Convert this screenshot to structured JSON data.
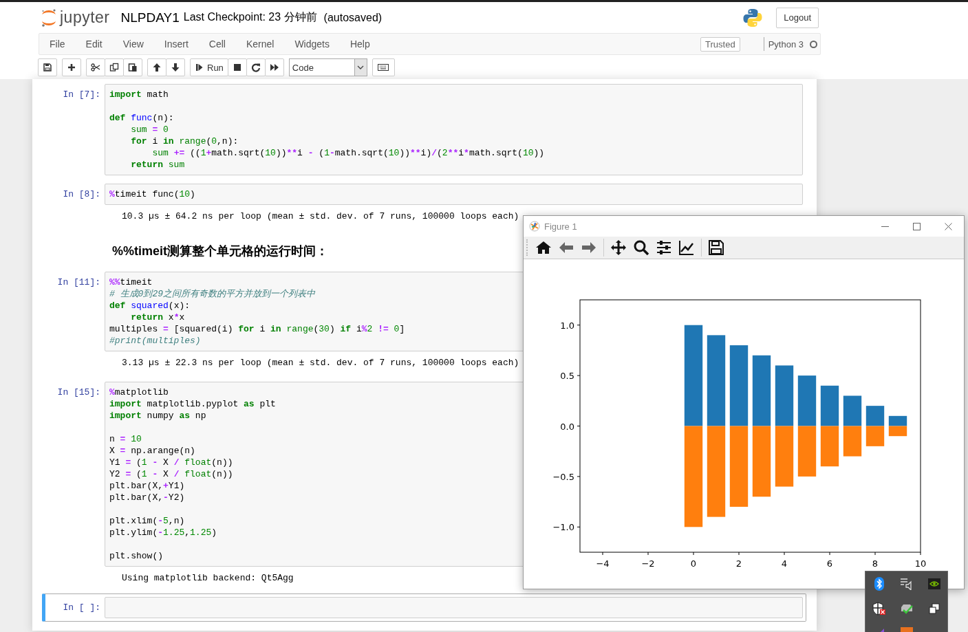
{
  "header": {
    "logo_text": "jupyter",
    "notebook_name": "NLPDAY1",
    "checkpoint": "Last Checkpoint: 23 分钟前",
    "autosave": "(autosaved)",
    "logout": "Logout"
  },
  "menu": [
    "File",
    "Edit",
    "View",
    "Insert",
    "Cell",
    "Kernel",
    "Widgets",
    "Help"
  ],
  "trusted": "Trusted",
  "kernel": {
    "name": "Python 3",
    "busy": false
  },
  "toolbar": {
    "run_label": "Run",
    "cell_type": "Code"
  },
  "cells": [
    {
      "kind": "code",
      "prompt": "In [7]:",
      "selected": false,
      "lines": [
        {
          "tokens": [
            {
              "kind": "kw",
              "text": "import"
            },
            {
              "kind": "name",
              "text": " math"
            }
          ]
        },
        {
          "space_before": true,
          "tokens": [
            {
              "kind": "kw",
              "text": "def"
            },
            {
              "kind": "fn",
              "text": " func"
            },
            {
              "kind": "name",
              "text": "(n):"
            }
          ]
        },
        {
          "tokens": [
            {
              "kind": "builtin",
              "text": "    sum"
            },
            {
              "kind": "op",
              "text": " ="
            },
            {
              "kind": "num",
              "text": " 0"
            }
          ]
        },
        {
          "tokens": [
            {
              "kind": "kw",
              "text": "    for"
            },
            {
              "kind": "name",
              "text": " i "
            },
            {
              "kind": "kw",
              "text": "in"
            },
            {
              "kind": "builtin",
              "text": " range"
            },
            {
              "kind": "name",
              "text": "("
            },
            {
              "kind": "num",
              "text": "0"
            },
            {
              "kind": "name",
              "text": ",n):"
            }
          ]
        },
        {
          "tokens": [
            {
              "kind": "builtin",
              "text": "        sum"
            },
            {
              "kind": "op",
              "text": " +="
            },
            {
              "kind": "name",
              "text": " (("
            },
            {
              "kind": "num",
              "text": "1"
            },
            {
              "kind": "op",
              "text": "+"
            },
            {
              "kind": "name",
              "text": "math.sqrt("
            },
            {
              "kind": "num",
              "text": "10"
            },
            {
              "kind": "name",
              "text": "))"
            },
            {
              "kind": "op",
              "text": "**"
            },
            {
              "kind": "name",
              "text": "i "
            },
            {
              "kind": "op",
              "text": "-"
            },
            {
              "kind": "name",
              "text": " ("
            },
            {
              "kind": "num",
              "text": "1"
            },
            {
              "kind": "op",
              "text": "-"
            },
            {
              "kind": "name",
              "text": "math.sqrt("
            },
            {
              "kind": "num",
              "text": "10"
            },
            {
              "kind": "name",
              "text": "))"
            },
            {
              "kind": "op",
              "text": "**"
            },
            {
              "kind": "name",
              "text": "i)"
            },
            {
              "kind": "op",
              "text": "/"
            },
            {
              "kind": "name",
              "text": "("
            },
            {
              "kind": "num",
              "text": "2"
            },
            {
              "kind": "op",
              "text": "**"
            },
            {
              "kind": "name",
              "text": "i"
            },
            {
              "kind": "op",
              "text": "*"
            },
            {
              "kind": "name",
              "text": "math.sqrt("
            },
            {
              "kind": "num",
              "text": "10"
            },
            {
              "kind": "name",
              "text": "))"
            }
          ]
        },
        {
          "tokens": [
            {
              "kind": "kw",
              "text": "    return"
            },
            {
              "kind": "builtin",
              "text": " sum"
            }
          ]
        }
      ]
    },
    {
      "kind": "code",
      "prompt": "In [8]:",
      "selected": false,
      "lines": [
        {
          "tokens": [
            {
              "kind": "magic",
              "text": "%"
            },
            {
              "kind": "name",
              "text": "timeit func("
            },
            {
              "kind": "num",
              "text": "10"
            },
            {
              "kind": "name",
              "text": ")"
            }
          ]
        }
      ],
      "output": "10.3 µs ± 64.2 ns per loop (mean ± std. dev. of 7 runs, 100000 loops each)"
    },
    {
      "kind": "markdown",
      "heading": "%%timeit测算整个单元格的运行时间："
    },
    {
      "kind": "code",
      "prompt": "In [11]:",
      "selected": false,
      "lines": [
        {
          "tokens": [
            {
              "kind": "magic",
              "text": "%%"
            },
            {
              "kind": "name",
              "text": "timeit"
            }
          ]
        },
        {
          "tokens": [
            {
              "kind": "comment",
              "text": "# 生成0到29之间所有奇数的平方并放到一个列表中"
            }
          ]
        },
        {
          "tokens": [
            {
              "kind": "kw",
              "text": "def"
            },
            {
              "kind": "fn",
              "text": " squared"
            },
            {
              "kind": "name",
              "text": "(x):"
            }
          ]
        },
        {
          "tokens": [
            {
              "kind": "kw",
              "text": "    return"
            },
            {
              "kind": "name",
              "text": " x"
            },
            {
              "kind": "op",
              "text": "*"
            },
            {
              "kind": "name",
              "text": "x"
            }
          ]
        },
        {
          "tokens": [
            {
              "kind": "name",
              "text": "multiples "
            },
            {
              "kind": "op",
              "text": "="
            },
            {
              "kind": "name",
              "text": " [squared(i) "
            },
            {
              "kind": "kw",
              "text": "for"
            },
            {
              "kind": "name",
              "text": " i "
            },
            {
              "kind": "kw",
              "text": "in"
            },
            {
              "kind": "builtin",
              "text": " range"
            },
            {
              "kind": "name",
              "text": "("
            },
            {
              "kind": "num",
              "text": "30"
            },
            {
              "kind": "name",
              "text": ") "
            },
            {
              "kind": "kw",
              "text": "if"
            },
            {
              "kind": "name",
              "text": " i"
            },
            {
              "kind": "op",
              "text": "%"
            },
            {
              "kind": "num",
              "text": "2"
            },
            {
              "kind": "op",
              "text": " !="
            },
            {
              "kind": "num",
              "text": " 0"
            },
            {
              "kind": "name",
              "text": "]"
            }
          ]
        },
        {
          "tokens": [
            {
              "kind": "comment",
              "text": "#print(multiples)"
            }
          ]
        }
      ],
      "output": "3.13 µs ± 22.3 ns per loop (mean ± std. dev. of 7 runs, 100000 loops each)"
    },
    {
      "kind": "code",
      "prompt": "In [15]:",
      "selected": false,
      "lines": [
        {
          "tokens": [
            {
              "kind": "magic",
              "text": "%"
            },
            {
              "kind": "name",
              "text": "matplotlib"
            }
          ]
        },
        {
          "tokens": [
            {
              "kind": "kw",
              "text": "import"
            },
            {
              "kind": "name",
              "text": " matplotlib.pyplot "
            },
            {
              "kind": "kw",
              "text": "as"
            },
            {
              "kind": "name",
              "text": " plt"
            }
          ]
        },
        {
          "tokens": [
            {
              "kind": "kw",
              "text": "import"
            },
            {
              "kind": "name",
              "text": " numpy "
            },
            {
              "kind": "kw",
              "text": "as"
            },
            {
              "kind": "name",
              "text": " np"
            }
          ]
        },
        {
          "space_before": true,
          "tokens": [
            {
              "kind": "name",
              "text": "n "
            },
            {
              "kind": "op",
              "text": "="
            },
            {
              "kind": "num",
              "text": " 10"
            }
          ]
        },
        {
          "tokens": [
            {
              "kind": "name",
              "text": "X "
            },
            {
              "kind": "op",
              "text": "="
            },
            {
              "kind": "name",
              "text": " np.arange(n)"
            }
          ]
        },
        {
          "tokens": [
            {
              "kind": "name",
              "text": "Y1 "
            },
            {
              "kind": "op",
              "text": "="
            },
            {
              "kind": "name",
              "text": " ("
            },
            {
              "kind": "num",
              "text": "1"
            },
            {
              "kind": "op",
              "text": " -"
            },
            {
              "kind": "name",
              "text": " X "
            },
            {
              "kind": "op",
              "text": "/"
            },
            {
              "kind": "builtin",
              "text": " float"
            },
            {
              "kind": "name",
              "text": "(n))"
            }
          ]
        },
        {
          "tokens": [
            {
              "kind": "name",
              "text": "Y2 "
            },
            {
              "kind": "op",
              "text": "="
            },
            {
              "kind": "name",
              "text": " ("
            },
            {
              "kind": "num",
              "text": "1"
            },
            {
              "kind": "op",
              "text": " -"
            },
            {
              "kind": "name",
              "text": " X "
            },
            {
              "kind": "op",
              "text": "/"
            },
            {
              "kind": "builtin",
              "text": " float"
            },
            {
              "kind": "name",
              "text": "(n))"
            }
          ]
        },
        {
          "tokens": [
            {
              "kind": "name",
              "text": "plt.bar(X,"
            },
            {
              "kind": "op",
              "text": "+"
            },
            {
              "kind": "name",
              "text": "Y1)"
            }
          ]
        },
        {
          "tokens": [
            {
              "kind": "name",
              "text": "plt.bar(X,"
            },
            {
              "kind": "op",
              "text": "-"
            },
            {
              "kind": "name",
              "text": "Y2)"
            }
          ]
        },
        {
          "space_before": true,
          "tokens": [
            {
              "kind": "name",
              "text": "plt.xlim("
            },
            {
              "kind": "op",
              "text": "-"
            },
            {
              "kind": "num",
              "text": "5"
            },
            {
              "kind": "name",
              "text": ",n)"
            }
          ]
        },
        {
          "tokens": [
            {
              "kind": "name",
              "text": "plt.ylim("
            },
            {
              "kind": "op",
              "text": "-"
            },
            {
              "kind": "num",
              "text": "1.25"
            },
            {
              "kind": "name",
              "text": ","
            },
            {
              "kind": "num",
              "text": "1.25"
            },
            {
              "kind": "name",
              "text": ")"
            }
          ]
        },
        {
          "space_before": true,
          "tokens": [
            {
              "kind": "name",
              "text": "plt.show()"
            }
          ]
        }
      ],
      "output": "Using matplotlib backend: Qt5Agg"
    },
    {
      "kind": "code",
      "prompt": "In [ ]:",
      "selected": true
    }
  ],
  "figure": {
    "title": "Figure 1",
    "chart_data": {
      "type": "bar",
      "stacked": true,
      "x": [
        0,
        1,
        2,
        3,
        4,
        5,
        6,
        7,
        8,
        9
      ],
      "series": [
        {
          "color": "#1f77b4",
          "values": [
            1.0,
            0.9,
            0.8,
            0.7,
            0.6,
            0.5,
            0.4,
            0.3,
            0.2,
            0.1
          ]
        },
        {
          "color": "#ff7f0e",
          "values": [
            -1.0,
            -0.9,
            -0.8,
            -0.7,
            -0.6,
            -0.5,
            -0.4,
            -0.3,
            -0.2,
            -0.1
          ]
        }
      ],
      "xlim": [
        -5,
        10
      ],
      "ylim": [
        -1.25,
        1.25
      ],
      "xticks": [
        {
          "value": -4,
          "label": "−4"
        },
        {
          "value": -2,
          "label": "−2"
        },
        0,
        2,
        4,
        6,
        8,
        10
      ],
      "yticks": [
        {
          "value": -1,
          "label": "−1.0"
        },
        {
          "value": -0.5,
          "label": "−0.5"
        },
        {
          "value": 0,
          "label": "0.0"
        },
        {
          "value": 0.5,
          "label": "0.5"
        },
        {
          "value": 1,
          "label": "1.0"
        }
      ]
    }
  }
}
